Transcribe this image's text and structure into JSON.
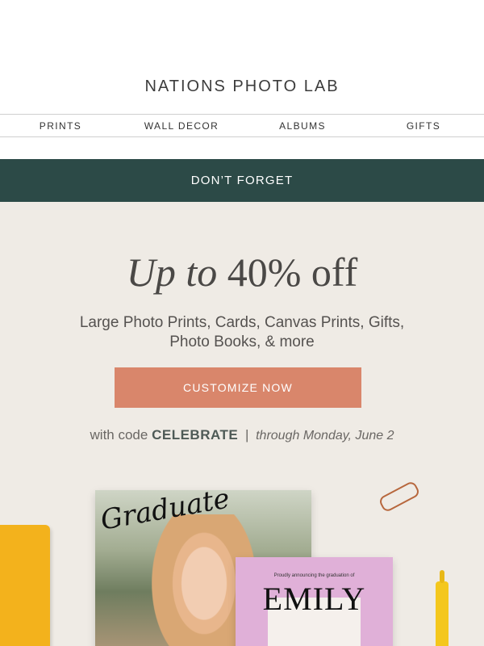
{
  "brand": "NATIONS PHOTO LAB",
  "nav": {
    "items": [
      "PRINTS",
      "WALL DECOR",
      "ALBUMS",
      "GIFTS"
    ]
  },
  "banner": "DON’T FORGET",
  "hero": {
    "headline_italic": "Up to",
    "headline_rest": "40% off",
    "subcopy": "Large Photo Prints, Cards, Canvas Prints, Gifts, Photo Books, & more",
    "cta_label": "CUSTOMIZE NOW",
    "promo_prefix": "with code",
    "promo_code": "CELEBRATE",
    "promo_separator": "|",
    "promo_dates": "through Monday, June 2"
  },
  "cards": {
    "main_script": "Graduate",
    "second_small": "Proudly announcing the graduation of",
    "second_name": "EMILY"
  },
  "colors": {
    "banner": "#2c4a47",
    "cta": "#d9866b",
    "hero_bg": "#efebe5"
  }
}
